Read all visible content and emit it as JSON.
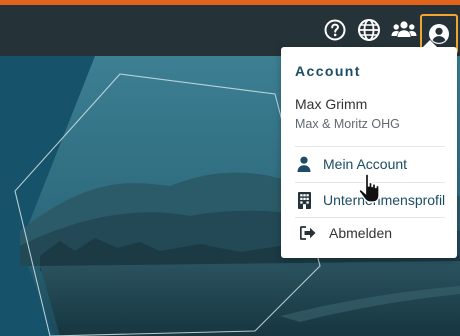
{
  "colors": {
    "accent": "#e2641c",
    "topbar": "#253238",
    "focus_ring": "#f3a52f",
    "brand_text": "#1d4d63"
  },
  "topbar": {
    "icons": [
      "help-icon",
      "language-globe-icon",
      "users-group-icon",
      "account-circle-icon"
    ]
  },
  "account_menu": {
    "title": "Account",
    "user_name": "Max Grimm",
    "company": "Max & Moritz OHG",
    "items": [
      {
        "label": "Mein Account",
        "icon": "user-icon"
      },
      {
        "label": "Unternehmensprofil",
        "icon": "building-icon"
      },
      {
        "label": "Abmelden",
        "icon": "logout-icon"
      }
    ]
  }
}
